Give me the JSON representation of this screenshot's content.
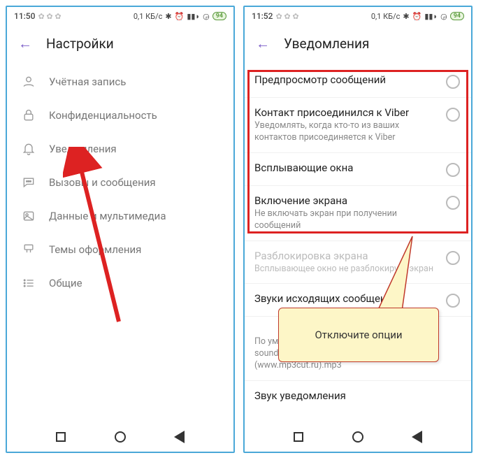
{
  "left": {
    "status": {
      "time": "11:50",
      "net": "0,1 КБ/с",
      "battery": "94"
    },
    "header": {
      "title": "Настройки"
    },
    "items": [
      {
        "label": "Учётная запись"
      },
      {
        "label": "Конфиденциальность"
      },
      {
        "label": "Уведомления"
      },
      {
        "label": "Вызовы и сообщения"
      },
      {
        "label": "Данные и мультимедиа"
      },
      {
        "label": "Темы оформления"
      },
      {
        "label": "Общие"
      }
    ]
  },
  "right": {
    "status": {
      "time": "11:52",
      "net": "0,1 КБ/с",
      "battery": "94"
    },
    "header": {
      "title": "Уведомления"
    },
    "items": [
      {
        "title": "Предпросмотр сообщений",
        "sub": ""
      },
      {
        "title": "Контакт присоединился к Viber",
        "sub": "Уведомлять, когда кто-то из ваших контактов присоединяется к Viber"
      },
      {
        "title": "Всплывающие окна",
        "sub": ""
      },
      {
        "title": "Включение экрана",
        "sub": "Не включать экран при получении сообщений"
      },
      {
        "title": "Разблокировка экрана",
        "sub": "Всплывающее окно не разблокирует экран"
      },
      {
        "title": "Звуки исходящих сообщений",
        "sub": ""
      },
      {
        "title": "",
        "sub": "По умолчанию (Le Matos - Summer Of 84 soundtrack (Film Version). HD (www.mp3cut.ru).mp3"
      },
      {
        "title": "Звук уведомления",
        "sub": ""
      }
    ]
  },
  "annotation": {
    "callout": "Отключите опции"
  }
}
